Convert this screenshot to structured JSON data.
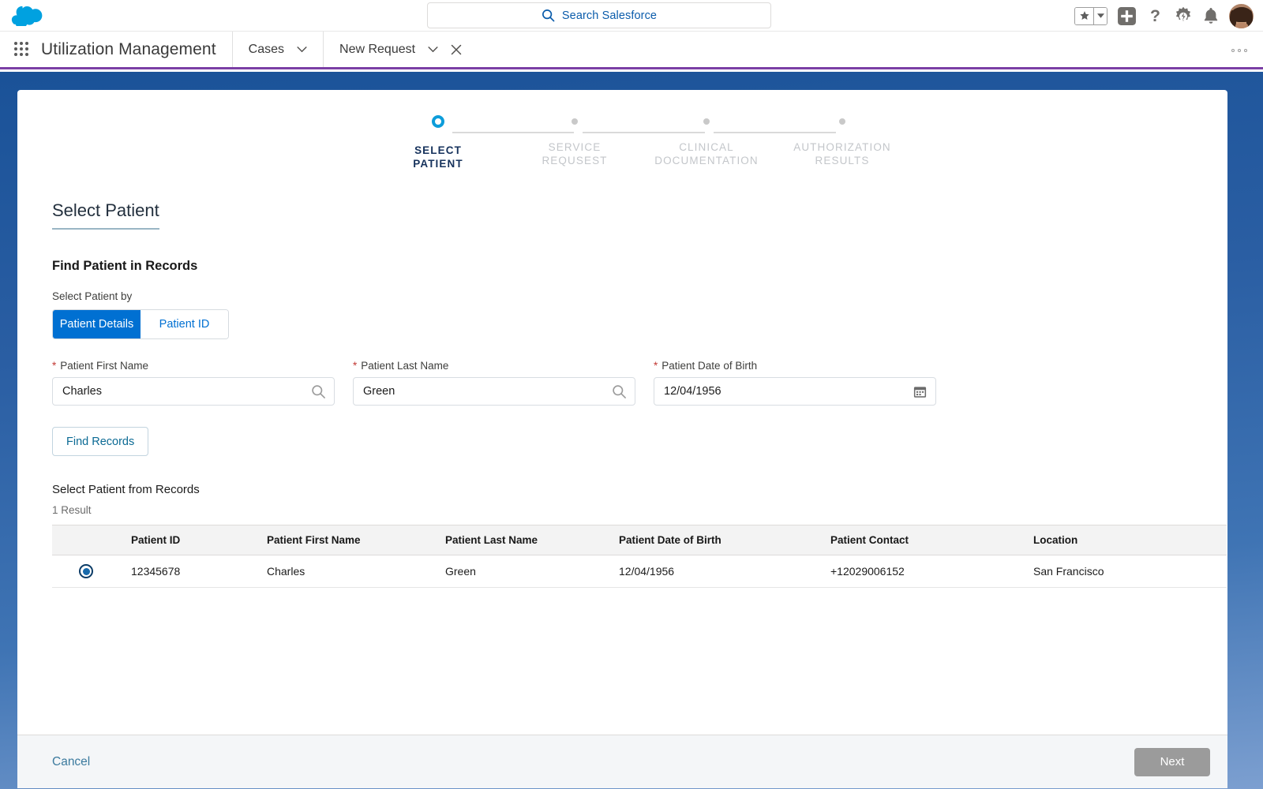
{
  "header": {
    "logo_icon": "salesforce-cloud-logo",
    "search": {
      "placeholder": "Search Salesforce",
      "icon": "search-icon"
    },
    "icons": {
      "favorite": "star-icon",
      "favorite_caret": "chevron-down-icon",
      "add": "plus-square-icon",
      "help": "question-mark-icon",
      "setup": "gear-icon",
      "notifications": "bell-icon",
      "avatar": "user-avatar"
    }
  },
  "tabbar": {
    "app_launcher_icon": "app-launcher-grid-icon",
    "app_name": "Utilization Management",
    "tabs": [
      {
        "label": "Cases",
        "caret_icon": "chevron-down-icon",
        "closable": false,
        "active": false
      },
      {
        "label": "New Request",
        "caret_icon": "chevron-down-icon",
        "close_icon": "close-icon",
        "closable": true,
        "active": true
      }
    ],
    "overflow_icon": "more-options-icon"
  },
  "progress": {
    "steps": [
      {
        "label": "SELECT\nPATIENT",
        "state": "active"
      },
      {
        "label": "SERVICE\nREQUSEST",
        "state": "upcoming"
      },
      {
        "label": "CLINICAL\nDOCUMENTATION",
        "state": "upcoming"
      },
      {
        "label": "AUTHORIZATION\nRESULTS",
        "state": "upcoming"
      }
    ]
  },
  "main": {
    "section_title": "Select Patient",
    "sub_title": "Find Patient in Records",
    "select_by_label": "Select Patient by",
    "toggle": {
      "options": [
        "Patient Details",
        "Patient ID"
      ],
      "selected": "Patient Details"
    },
    "fields": [
      {
        "label": "Patient First Name",
        "required": true,
        "value": "Charles",
        "icon": "search-icon"
      },
      {
        "label": "Patient Last Name",
        "required": true,
        "value": "Green",
        "icon": "search-icon"
      },
      {
        "label": "Patient Date of Birth",
        "required": true,
        "value": "12/04/1956",
        "icon": "calendar-icon"
      }
    ],
    "find_records_label": "Find Records",
    "records_title": "Select Patient from Records",
    "result_count": "1 Result",
    "table": {
      "columns": [
        "Patient ID",
        "Patient First Name",
        "Patient Last Name",
        "Patient Date of Birth",
        "Patient Contact",
        "Location"
      ],
      "rows": [
        {
          "selected": true,
          "patient_id": "12345678",
          "first_name": "Charles",
          "last_name": "Green",
          "dob": "12/04/1956",
          "contact": "+12029006152",
          "location": "San Francisco"
        }
      ]
    }
  },
  "footer": {
    "cancel_label": "Cancel",
    "next_label": "Next",
    "next_disabled": true
  },
  "colors": {
    "brand_blue": "#0070d2",
    "accent_cyan": "#0d9dda",
    "tab_underline_purple": "#7b3fa5",
    "backdrop_blue": "#1a5298",
    "required_red": "#c23934",
    "link_teal": "#3b7a9e",
    "disabled_gray": "#9b9b9b"
  }
}
